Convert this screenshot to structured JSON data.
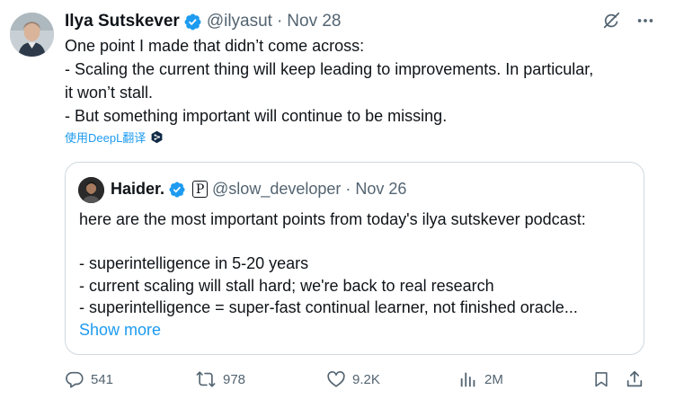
{
  "tweet": {
    "author_name": "Ilya Sutskever",
    "handle": "@ilyasut",
    "separator": "·",
    "date": "Nov 28",
    "text_lines": [
      "One point I made that didn’t come across:",
      "- Scaling the current thing will keep leading to improvements.  In particular,",
      "it won’t stall.",
      "- But something important will continue to be missing."
    ],
    "translate_label": "使用DeepL翻译"
  },
  "quote": {
    "author_name": "Haider.",
    "badge_letter": "P",
    "handle": "@slow_developer",
    "separator": "·",
    "date": "Nov 26",
    "lines": [
      "here are the most important points from today's ilya sutskever podcast:",
      "",
      "- superintelligence in 5-20 years",
      "- current scaling will stall hard; we're back to real research",
      "- superintelligence = super-fast continual learner, not finished oracle..."
    ],
    "show_more_label": "Show more"
  },
  "actions": {
    "replies": "541",
    "reposts": "978",
    "likes": "9.2K",
    "views": "2M"
  },
  "icons": {
    "verified": "verified-badge-icon",
    "grok": "grok-icon",
    "more": "more-icon",
    "reply": "reply-icon",
    "repost": "repost-icon",
    "like": "like-icon",
    "views": "views-icon",
    "bookmark": "bookmark-icon",
    "share": "share-icon",
    "deepl": "deepl-icon"
  },
  "colors": {
    "accent": "#1d9bf0",
    "text": "#0f1419",
    "secondary": "#536471",
    "border": "#cfd9de"
  }
}
